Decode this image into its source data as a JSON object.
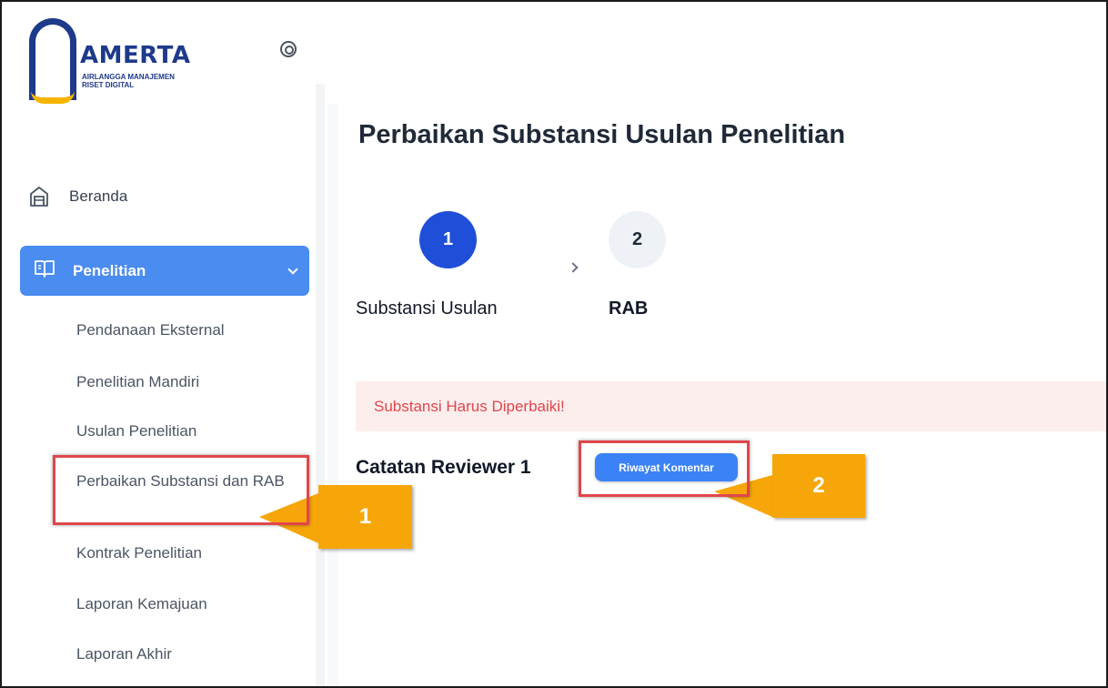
{
  "logo": {
    "title": "AMERTA",
    "subtitle_line1": "AIRLANGGA MANAJEMEN",
    "subtitle_line2": "RISET DIGITAL"
  },
  "sidebar": {
    "home": {
      "label": "Beranda",
      "icon": "home-icon"
    },
    "active": {
      "label": "Penelitian",
      "icon": "book-icon"
    },
    "items": [
      {
        "label": "Pendanaan Eksternal"
      },
      {
        "label": "Penelitian Mandiri"
      },
      {
        "label": "Usulan Penelitian"
      },
      {
        "label": "Perbaikan Substansi dan RAB"
      },
      {
        "label": "Kontrak Penelitian"
      },
      {
        "label": "Laporan Kemajuan"
      },
      {
        "label": "Laporan Akhir"
      }
    ]
  },
  "page": {
    "title": "Perbaikan Substansi Usulan Penelitian",
    "steps": [
      {
        "number": "1",
        "label": "Substansi Usulan"
      },
      {
        "number": "2",
        "label": "RAB"
      }
    ],
    "alert": "Substansi Harus Diperbaiki!",
    "reviewer_label": "Catatan Reviewer 1",
    "comment_button": "Riwayat Komentar"
  },
  "annotations": [
    {
      "label": "1"
    },
    {
      "label": "2"
    }
  ],
  "colors": {
    "primary": "#4a8cf0",
    "step_active": "#1f4ed8",
    "alert_bg": "#fdeeee",
    "alert_text": "#e0464b",
    "callout": "#f6a609",
    "highlight": "#e0464b",
    "logo_blue": "#1e3a8a",
    "logo_gold": "#f5b400"
  }
}
